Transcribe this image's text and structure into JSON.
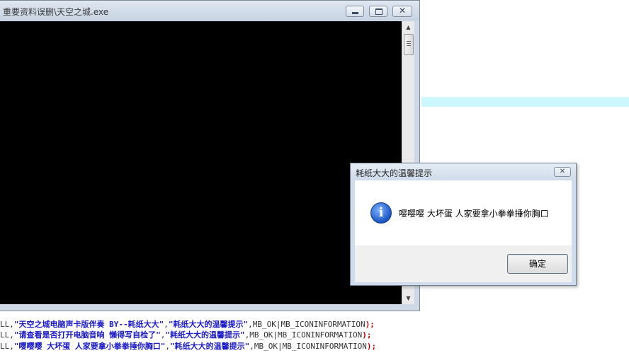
{
  "console_window": {
    "title": "重要资料误删\\天空之城.exe",
    "minimize_glyph": "",
    "maximize_glyph": "",
    "close_glyph": "✕"
  },
  "scrollbar": {
    "up_arrow": "▲",
    "down_arrow": "▼"
  },
  "code_lines": [
    {
      "prefix": "LL,",
      "text": "\"天空之城电脑声卡版伴奏  BY--耗纸大大\"",
      "sep": ",",
      "caption": "\"耗纸大大的温馨提示\"",
      "flags": ",MB_OK|MB_ICONINFORMATION",
      "end": ");"
    },
    {
      "prefix": "LL,",
      "text": "\"请查看是否打开电脑音响 懒得写自检了\"",
      "sep": ",",
      "caption": "\"耗纸大大的温馨提示\"",
      "flags": ",MB_OK|MB_ICONINFORMATION",
      "end": ");"
    },
    {
      "prefix": "LL,",
      "text": "\"嘤嘤嘤 大坏蛋 人家要拿小拳拳捶你胸口\"",
      "sep": ",",
      "caption": "\"耗纸大大的温馨提示\"",
      "flags": ",MB_OK|MB_ICONINFORMATION",
      "end": ");"
    }
  ],
  "message_box": {
    "title": "耗纸大大的温馨提示",
    "close_glyph": "✕",
    "icon": "info-icon",
    "icon_glyph": "i",
    "message": "嘤嘤嘤 大坏蛋 人家要拿小拳拳捶你胸口",
    "ok_label": "确定"
  },
  "colors": {
    "console_bg": "#000000",
    "highlight_band": "#ccf7ff",
    "string_blue": "#1a1ac8",
    "paren_red": "#c00000"
  }
}
